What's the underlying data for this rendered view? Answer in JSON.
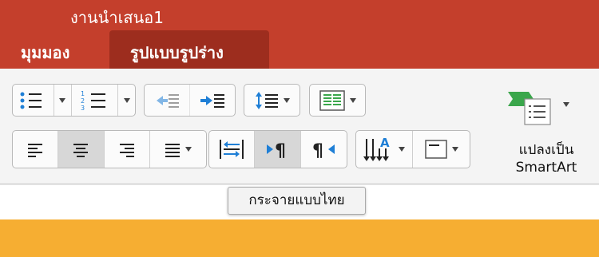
{
  "window": {
    "title": "งานนำเสนอ1"
  },
  "tabs": [
    {
      "label": "มุมมอง",
      "active": false
    },
    {
      "label": "รูปแบบรูปร่าง",
      "active": true
    }
  ],
  "ribbon": {
    "paragraph": {
      "bullets": {
        "icon": "bullets-icon",
        "has_dropdown": true
      },
      "numbering": {
        "icon": "numbering-icon",
        "digits": [
          "1",
          "2",
          "3"
        ],
        "has_dropdown": true
      },
      "decrease_indent": {
        "icon": "decrease-indent-icon",
        "enabled": false
      },
      "increase_indent": {
        "icon": "increase-indent-icon",
        "enabled": true
      },
      "line_spacing": {
        "icon": "line-spacing-icon",
        "has_dropdown": true
      },
      "columns": {
        "icon": "columns-icon",
        "has_dropdown": true
      },
      "align_left": {
        "icon": "align-left-icon",
        "pressed": false
      },
      "align_center": {
        "icon": "align-center-icon",
        "pressed": true
      },
      "align_right": {
        "icon": "align-right-icon",
        "pressed": false
      },
      "justify": {
        "icon": "justify-icon",
        "has_dropdown": true
      },
      "thai_distributed": {
        "icon": "thai-distributed-icon",
        "pressed": false
      },
      "ltr": {
        "icon": "left-to-right-icon",
        "pressed": true
      },
      "rtl": {
        "icon": "right-to-left-icon",
        "pressed": false
      },
      "text_direction": {
        "icon": "text-direction-icon",
        "glyph": "A",
        "has_dropdown": true
      },
      "align_text": {
        "icon": "align-text-icon",
        "has_dropdown": true
      }
    },
    "smartart": {
      "icon": "convert-smartart-icon",
      "label_line1": "แปลงเป็น",
      "label_line2": "SmartArt",
      "has_dropdown": true
    }
  },
  "tooltip": {
    "text": "กระจายแบบไทย"
  },
  "colors": {
    "title_bar": "#c43f2c",
    "active_tab": "#9d2d1e",
    "accent_blue": "#1f7fd6",
    "smartart_green": "#3aa64b",
    "slide_background": "#f6ae32"
  }
}
